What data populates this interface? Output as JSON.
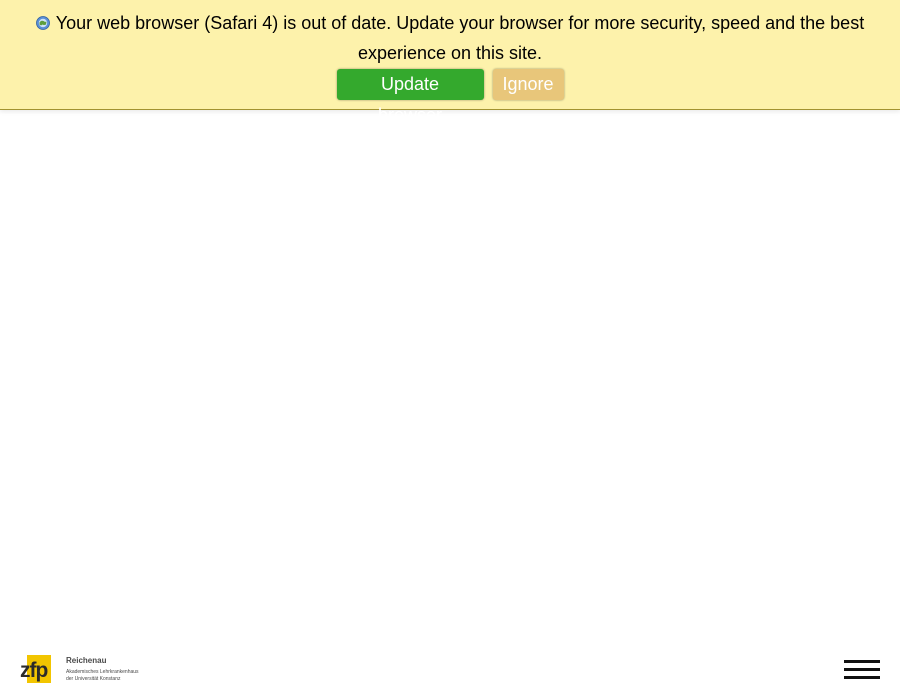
{
  "banner": {
    "message": "Your web browser (Safari 4) is out of date. Update your browser for more security, speed and the best experience on this site.",
    "update_label": "Update browser",
    "ignore_label": "Ignore",
    "icon": "browser-globe-icon",
    "background_color": "#fdf2ab",
    "update_color": "#34a92d",
    "ignore_color": "#e8c67a"
  },
  "footer": {
    "logo": {
      "mark": "zfp",
      "name": "Reichenau",
      "subtitle_line1": "Akademisches Lehrkrankenhaus",
      "subtitle_line2": "der Universität Konstanz",
      "mark_color": "#f2c500"
    },
    "menu_icon": "hamburger-menu-icon"
  }
}
